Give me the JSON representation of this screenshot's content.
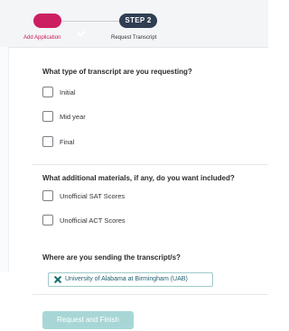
{
  "stepper": {
    "step1": {
      "label": "Add Application",
      "status": "complete",
      "icon": "check-icon"
    },
    "step2": {
      "pill": "STEP 2",
      "label": "Request Transcript",
      "status": "current"
    }
  },
  "questions": {
    "transcript_type": {
      "label": "What type of transcript are you requesting?",
      "options": [
        {
          "label": "Initial",
          "checked": false
        },
        {
          "label": "Mid year",
          "checked": false
        },
        {
          "label": "Final",
          "checked": false
        }
      ]
    },
    "additional_materials": {
      "label": "What additional materials, if any, do you want included?",
      "options": [
        {
          "label": "Unofficial SAT Scores",
          "checked": false
        },
        {
          "label": "Unofficial ACT Scores",
          "checked": false
        }
      ]
    },
    "destination": {
      "label": "Where are you sending the transcript/s?",
      "selected": {
        "label": "University of Alabama at Birmingham (UAB)",
        "icon": "x-icon"
      }
    }
  },
  "actions": {
    "finish_label": "Request and Finish",
    "finish_enabled": false
  },
  "colors": {
    "primary": "#cc1f62",
    "dark": "#2f3e52",
    "accent": "#0f6b6b",
    "button_disabled": "#a8d6d6"
  }
}
